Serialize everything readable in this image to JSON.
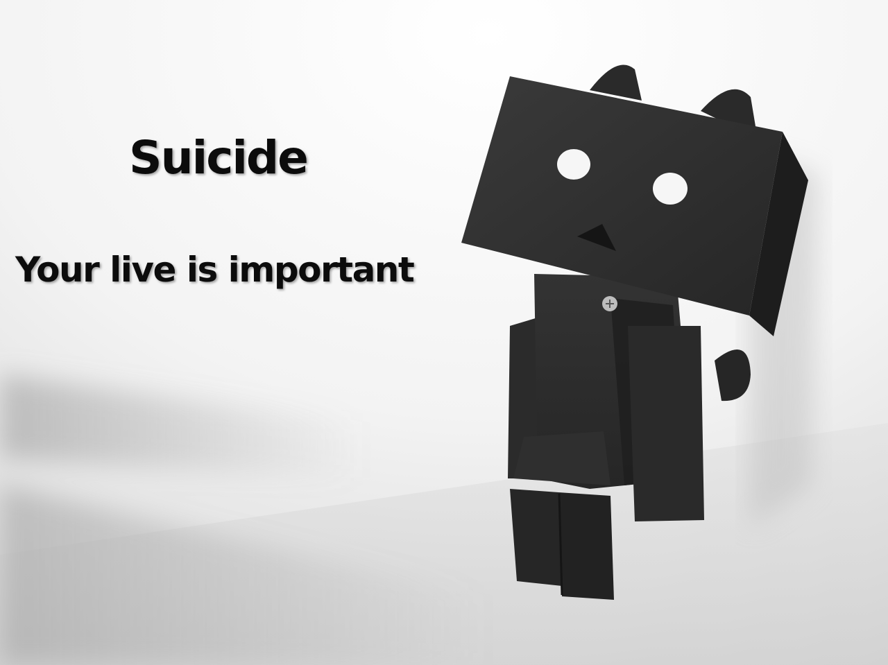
{
  "overlay": {
    "title": "Suicide",
    "subtitle": "Your live is important"
  },
  "colors": {
    "wall": "#ececec",
    "figure": "#2d2d2d",
    "figure_shadow": "#1b1b1b",
    "text": "#0c0c0c"
  }
}
